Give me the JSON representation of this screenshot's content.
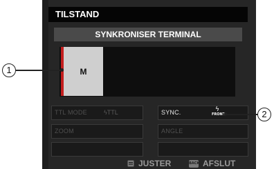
{
  "header": {
    "title": "TILSTAND"
  },
  "sync_header": {
    "label": "SYNKRONISER TERMINAL"
  },
  "group": {
    "label": "M",
    "accent_color": "#c41e1e"
  },
  "settings": {
    "ttl_mode": {
      "label": "TTL MODE",
      "value": "ϟTTL"
    },
    "sync": {
      "label": "SYNC.",
      "icon": "flash-icon",
      "value": "FRONT"
    },
    "zoom": {
      "label": "ZOOM"
    },
    "angle": {
      "label": "ANGLE"
    }
  },
  "footer": {
    "juster_label": "JUSTER",
    "afslut_label": "AFSLUT",
    "back_icon_text": "BACK"
  },
  "callouts": {
    "one": "1",
    "two": "2"
  }
}
